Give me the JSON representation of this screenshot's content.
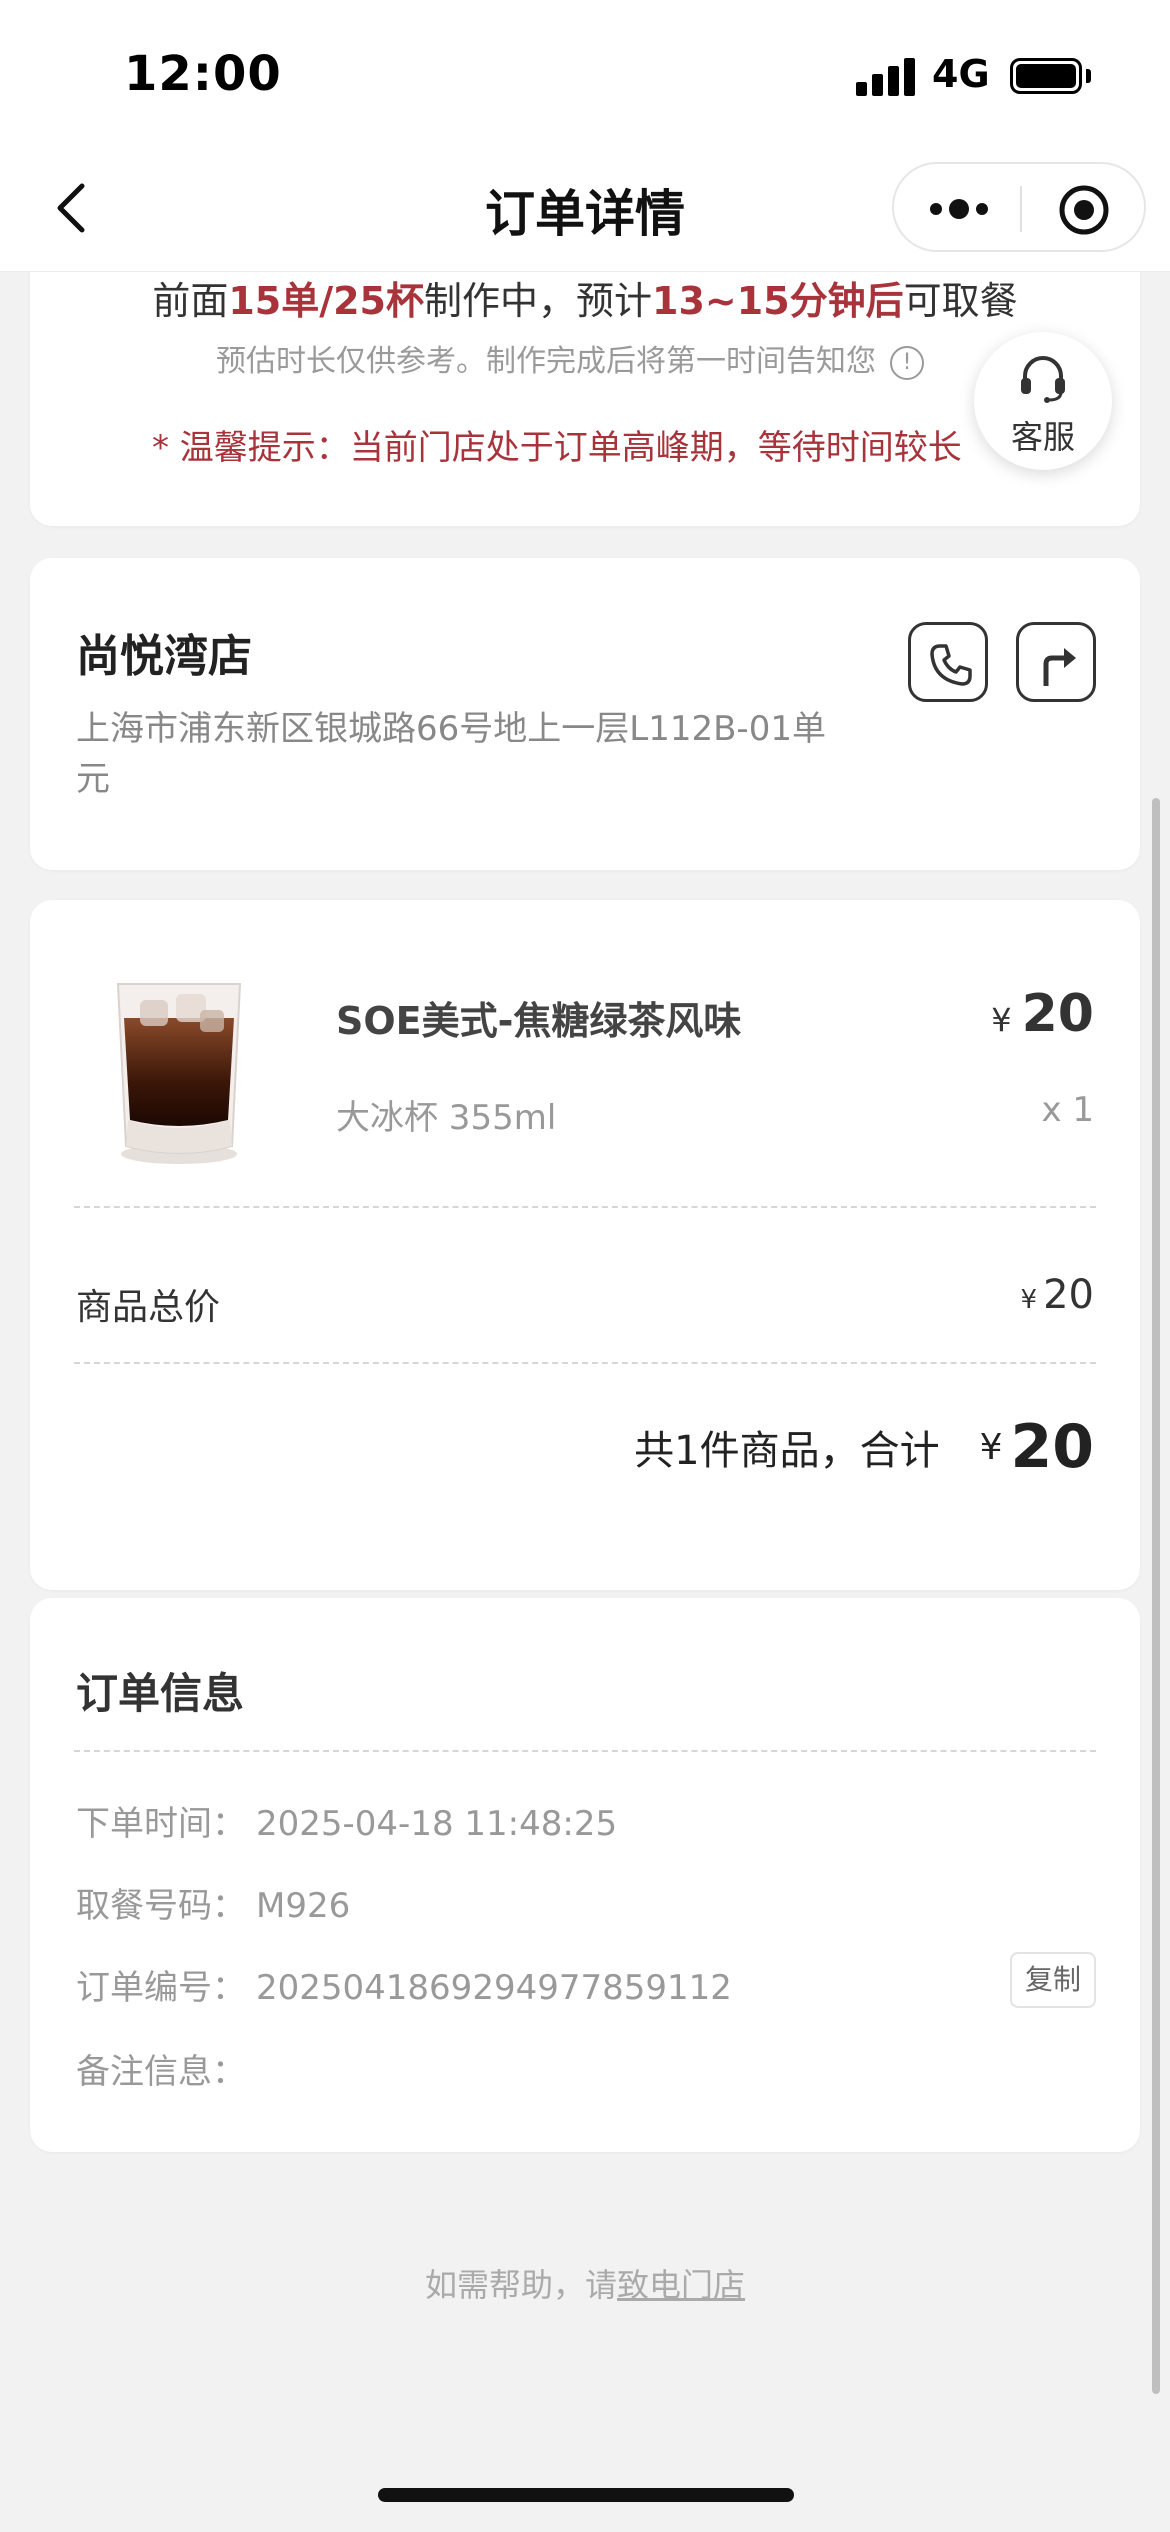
{
  "status_bar": {
    "time": "12:00",
    "network": "4G"
  },
  "nav": {
    "title": "订单详情"
  },
  "wait_card": {
    "queue_prefix": "前面",
    "queue_count": "15单/25杯",
    "queue_mid": "制作中，预计",
    "queue_time": "13~15分钟后",
    "queue_suffix": "可取餐",
    "estimate_note": "预估时长仅供参考。制作完成后将第一时间告知您",
    "info_glyph": "!",
    "warm_tip": "* 温馨提示：当前门店处于订单高峰期，等待时间较长"
  },
  "customer_service": {
    "label": "客服"
  },
  "store": {
    "name": "尚悦湾店",
    "address": "上海市浦东新区银城路66号地上一层L112B-01单元"
  },
  "order": {
    "product_name": "SOE美式-焦糖绿茶风味",
    "product_spec": "大冰杯 355ml",
    "currency": "¥",
    "price": "20",
    "quantity": "x 1",
    "subtotal_label": "商品总价",
    "subtotal": "20",
    "total_label": "共1件商品，合计",
    "total": "20"
  },
  "order_info": {
    "title": "订单信息",
    "order_time_label": "下单时间：",
    "order_time": "2025-04-18 11:48:25",
    "pickup_code_label": "取餐号码：",
    "pickup_code": "M926",
    "order_no_label": "订单编号：",
    "order_no": "20250418692949778591‍12",
    "copy_label": "复制",
    "remark_label": "备注信息："
  },
  "help": {
    "prefix": "如需帮助，请",
    "link": "致电门店"
  },
  "colors": {
    "accent_red": "#a8333b",
    "background": "#f2f2f2"
  }
}
